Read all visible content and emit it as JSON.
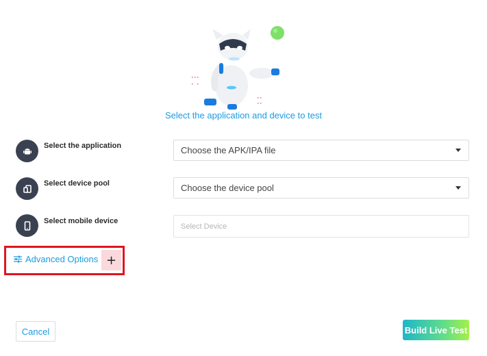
{
  "hero": {
    "illustration_icon": "robot-mascot-icon",
    "subtitle": "Select the application and device to test"
  },
  "form": {
    "application": {
      "icon": "android-icon",
      "label": "Select the application",
      "selected": "Choose the APK/IPA file"
    },
    "device_pool": {
      "icon": "device-pool-icon",
      "label": "Select device pool",
      "selected": "Choose the device pool"
    },
    "mobile_device": {
      "icon": "mobile-phone-icon",
      "label": "Select mobile device",
      "placeholder": "Select Device"
    }
  },
  "advanced": {
    "icon": "sliders-icon",
    "label": "Advanced Options",
    "toggle_symbol": "+"
  },
  "footer": {
    "cancel_label": "Cancel",
    "build_label": "Build Live Test"
  },
  "colors": {
    "accent": "#1a9be0",
    "icon_circle": "#3a4150",
    "highlight": "#e0141e",
    "toggle_bg": "#fbd8dc",
    "build_gradient_start": "#1fb6c9",
    "build_gradient_end": "#a4f04a"
  }
}
